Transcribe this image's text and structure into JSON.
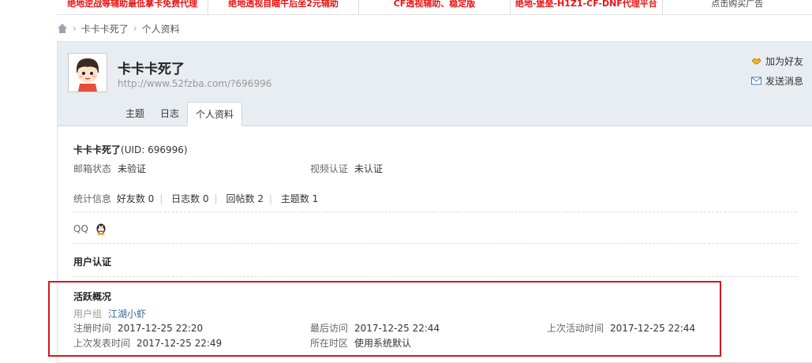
{
  "ads": [
    {
      "text": "绝地逆战等辅助最低拿卡免费代理"
    },
    {
      "text": "绝地透视自瞄午后坐2元辅助"
    },
    {
      "text": "CF透视辅助、稳定版"
    },
    {
      "text": "绝地-堡垒-H1Z1-CF-DNF代理平台"
    },
    {
      "text": "点击购买广告"
    }
  ],
  "breadcrumb": {
    "user": "卡卡卡死了",
    "page": "个人资料"
  },
  "profile": {
    "name": "卡卡卡死了",
    "url": "http://www.52fzba.com/?696996",
    "actions": {
      "add_friend": "加为好友",
      "send_message": "发送消息"
    },
    "tabs": [
      "主题",
      "日志",
      "个人资料"
    ]
  },
  "info": {
    "name_uid": "卡卡卡死了",
    "uid_text": "(UID: 696996)",
    "email_label": "邮箱状态",
    "email_value": "未验证",
    "video_label": "视频认证",
    "video_value": "未认证",
    "stats_label": "统计信息",
    "stats": [
      "好友数 0",
      "日志数 0",
      "回帖数 2",
      "主题数 1"
    ],
    "qq_label": "QQ",
    "user_cert_title": "用户认证"
  },
  "activity": {
    "title": "活跃概况",
    "group_label": "用户组",
    "group_value": "江湖小虾",
    "reg_label": "注册时间",
    "reg_value": "2017-12-25 22:20",
    "last_visit_label": "最后访问",
    "last_visit_value": "2017-12-25 22:44",
    "last_active_label": "上次活动时间",
    "last_active_value": "2017-12-25 22:44",
    "last_post_label": "上次发表时间",
    "last_post_value": "2017-12-25 22:49",
    "timezone_label": "所在时区",
    "timezone_value": "使用系统默认"
  },
  "colors": {
    "highlight": "#d9161e",
    "header_bg": "#e8edf2",
    "ad_red": "#e11111",
    "link": "#336699"
  }
}
